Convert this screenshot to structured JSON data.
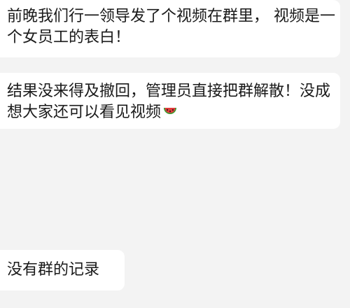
{
  "messages": [
    {
      "lines": [
        "前晚我们行一领导发了个视频在群里， 视频是一",
        "个女员工的表白！"
      ]
    },
    {
      "lines": [
        "结果没来得及撤回，管理员直接把群解散！没成",
        "想大家还可以看见视频"
      ],
      "trailing_icon": "watermelon-icon"
    },
    {
      "lines": [
        "没有群的记录"
      ]
    }
  ],
  "colors": {
    "background": "#f3f3f3",
    "bubble": "#ffffff",
    "text": "#1a1a1a"
  }
}
